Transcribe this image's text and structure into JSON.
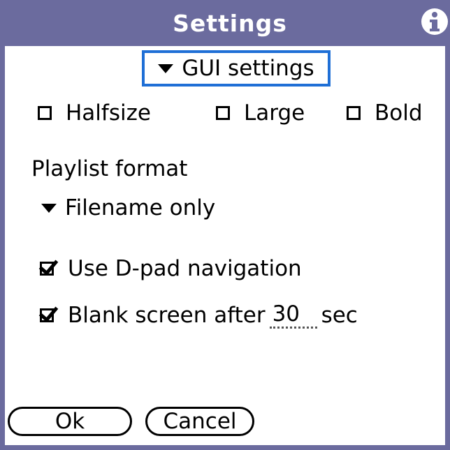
{
  "window": {
    "title": "Settings",
    "info_icon": "info-icon"
  },
  "section_picker": {
    "label": "GUI settings"
  },
  "font_options": [
    {
      "label": "Halfsize",
      "checked": false
    },
    {
      "label": "Large",
      "checked": false
    },
    {
      "label": "Bold",
      "checked": false
    }
  ],
  "playlist": {
    "label": "Playlist format",
    "value": "Filename only"
  },
  "options": {
    "dpad_label": "Use D-pad navigation",
    "dpad_checked": true,
    "blank_label": "Blank screen after",
    "blank_value": "30",
    "blank_unit": "sec",
    "blank_checked": true
  },
  "buttons": {
    "ok": "Ok",
    "cancel": "Cancel"
  },
  "colors": {
    "titlebar": "#6b6b9e",
    "focus_ring": "#1f6fd6"
  }
}
